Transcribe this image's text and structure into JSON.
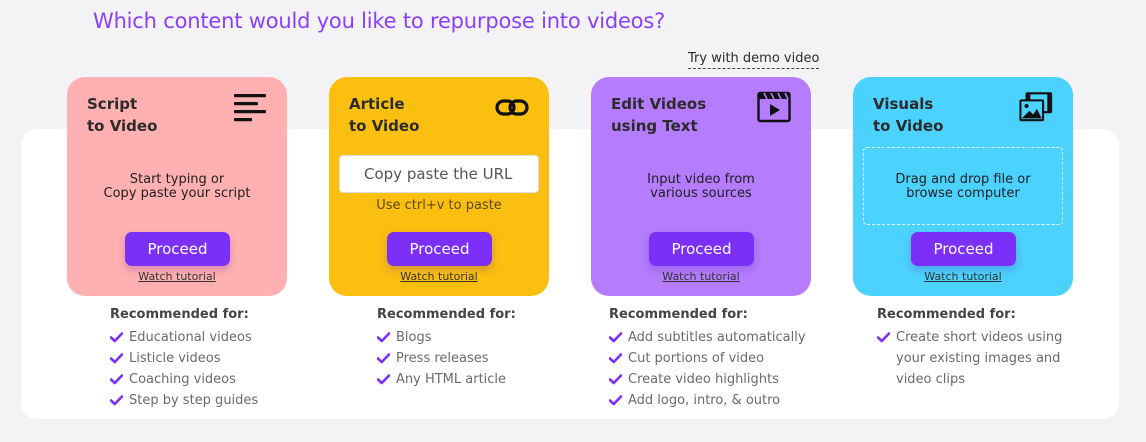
{
  "heading": "Which content would you like to repurpose into videos?",
  "demo_link": "Try with demo video",
  "proceed_label": "Proceed",
  "tutorial_label": "Watch tutorial",
  "recommended_label": "Recommended for:",
  "colors": {
    "accent": "#7b2ff7",
    "heading": "#8a3ffc",
    "script_card": "#ffb0b0",
    "article_card": "#fbbf10",
    "edit_card": "#b57cfe",
    "visuals_card": "#4cd2fe"
  },
  "cards": [
    {
      "title_line1": "Script",
      "title_line2": "to Video",
      "icon": "text-lines-icon",
      "body_line1": "Start typing or",
      "body_line2": "Copy paste your script",
      "recommended": [
        "Educational videos",
        "Listicle videos",
        "Coaching videos",
        "Step by step guides"
      ]
    },
    {
      "title_line1": "Article",
      "title_line2": "to Video",
      "icon": "link-icon",
      "input_placeholder": "Copy paste the URL",
      "input_hint": "Use ctrl+v to paste",
      "recommended": [
        "Blogs",
        "Press releases",
        "Any HTML article"
      ]
    },
    {
      "title_line1": "Edit Videos",
      "title_line2": "using Text",
      "icon": "video-clapper-icon",
      "body_line1": "Input video from",
      "body_line2": "various sources",
      "recommended": [
        "Add subtitles automatically",
        "Cut portions of video",
        "Create video highlights",
        "Add logo, intro, & outro"
      ]
    },
    {
      "title_line1": "Visuals",
      "title_line2": "to Video",
      "icon": "images-film-icon",
      "body_line1": "Drag and drop file or",
      "body_line2": "browse computer",
      "recommended": [
        "Create short videos using",
        "your existing images and",
        "video clips"
      ]
    }
  ]
}
